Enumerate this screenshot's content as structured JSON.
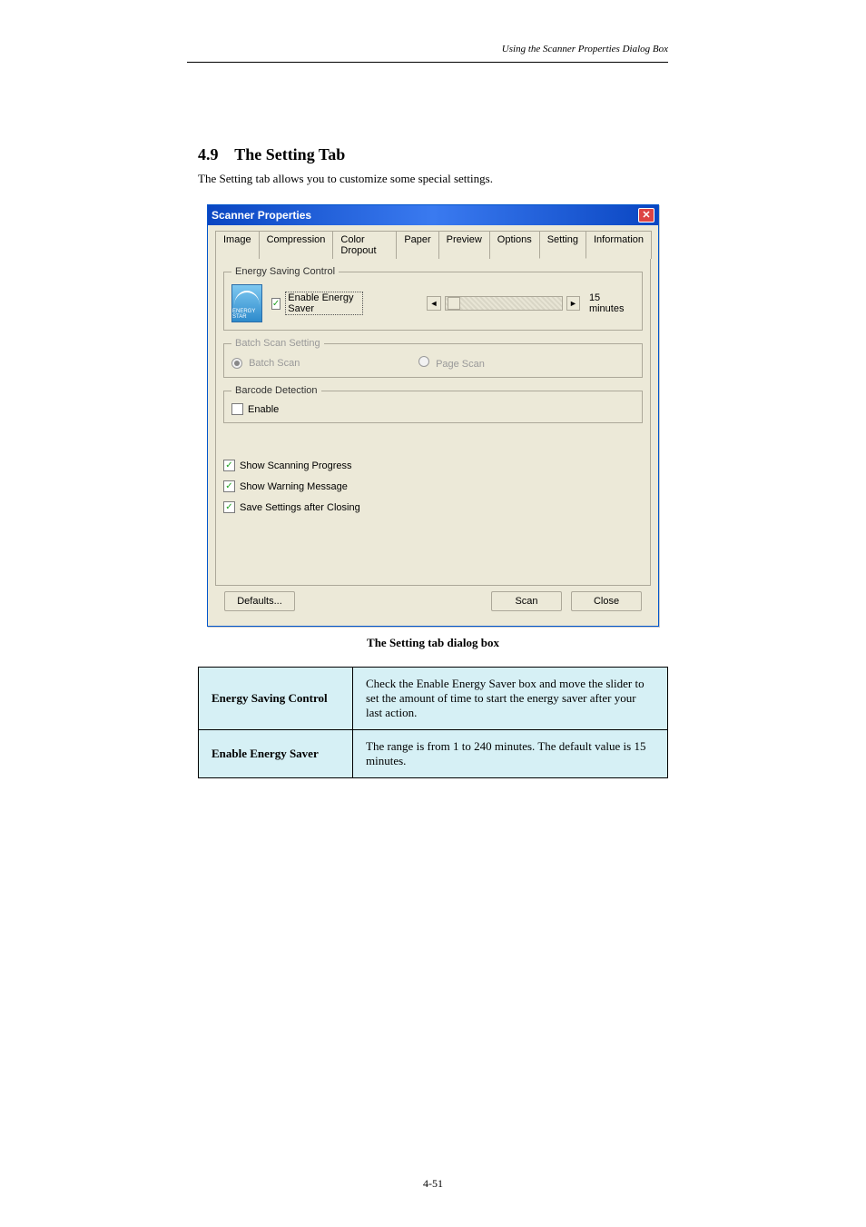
{
  "page": {
    "header_right": "Using the Scanner Properties Dialog Box",
    "section_number": "4.9",
    "section_title": "The Setting Tab",
    "section_desc": "The Setting tab allows you to customize some special settings.",
    "caption": "The Setting tab dialog box",
    "footer_page": "4-51"
  },
  "dialog": {
    "title": "Scanner Properties",
    "tabs": {
      "image": "Image",
      "compression": "Compression",
      "color_dropout": "Color Dropout",
      "paper": "Paper",
      "preview": "Preview",
      "options": "Options",
      "setting": "Setting",
      "information": "Information"
    },
    "energy": {
      "legend": "Energy Saving Control",
      "logo_text": "ENERGY STAR",
      "enable_label": "Enable Energy Saver",
      "slider_value": "15 minutes"
    },
    "batch": {
      "legend": "Batch Scan Setting",
      "batch_scan": "Batch Scan",
      "page_scan": "Page Scan"
    },
    "barcode": {
      "legend": "Barcode Detection",
      "enable": "Enable"
    },
    "opts": {
      "show_progress": "Show Scanning Progress",
      "show_warning": "Show Warning Message",
      "save_settings": "Save Settings after Closing"
    },
    "buttons": {
      "defaults": "Defaults...",
      "scan": "Scan",
      "close": "Close"
    }
  },
  "table": {
    "row1_label": "Energy Saving Control",
    "row1_text": "Check the Enable Energy Saver box and move the slider to set the amount of time to start the energy saver after your last action.",
    "row2_label": "Enable Energy Saver",
    "row2_text": "The range is from 1 to 240 minutes. The default value is 15 minutes."
  }
}
